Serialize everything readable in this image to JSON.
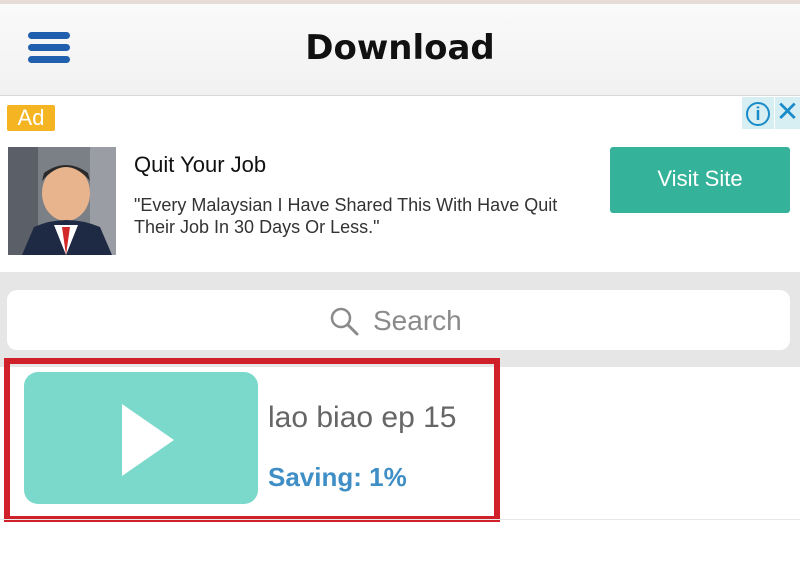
{
  "header": {
    "title": "Download"
  },
  "ad": {
    "badge": "Ad",
    "info_icon": "info-icon",
    "close_icon": "close-icon",
    "headline": "Quit Your Job",
    "body": "\"Every Malaysian I Have Shared This With Have Quit Their Job In 30 Days Or Less.\"",
    "cta": "Visit Site",
    "cta_color": "#35b39a"
  },
  "search": {
    "placeholder": "Search"
  },
  "downloads": [
    {
      "title": "lao biao ep 15",
      "status": "Saving: 1%",
      "progress_percent": 1,
      "thumbnail_color": "#7ad9cb",
      "highlighted": true
    }
  ],
  "colors": {
    "accent": "#1f5fad",
    "highlight_border": "#d0202a",
    "status_text": "#3f8ec6",
    "ad_badge": "#f5b523"
  }
}
